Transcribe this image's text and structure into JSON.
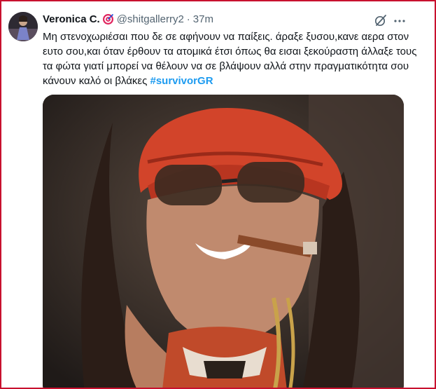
{
  "tweet": {
    "display_name": "Veronica C.",
    "badge_icon": "target-icon",
    "handle": "@shitgallerry2",
    "separator": "·",
    "time": "37m",
    "text": "Μη στενοχωριέσαι που δε σε αφήνουν να παίξεις. άραξε ξυσου,κανε αερα στον ευτο σου,και όταν έρθουν τα ατομικά έτσι όπως θα εισαι ξεκούραστη άλλαξε τους τα φώτα γιατί μπορεί να θέλουν να σε βλάψουν αλλά στην πραγματικότητα σου κάνουν καλό οι βλάκες",
    "hashtag": "#survivorGR",
    "grok_icon": "grok-icon",
    "more_icon": "more-options-icon",
    "media_alt": "Photo of a smiling woman wearing an orange bandana, sunglasses and a cigar"
  },
  "colors": {
    "hashtag": "#1d9bf0",
    "secondary_text": "#536471",
    "frame_border": "#c8102e"
  }
}
